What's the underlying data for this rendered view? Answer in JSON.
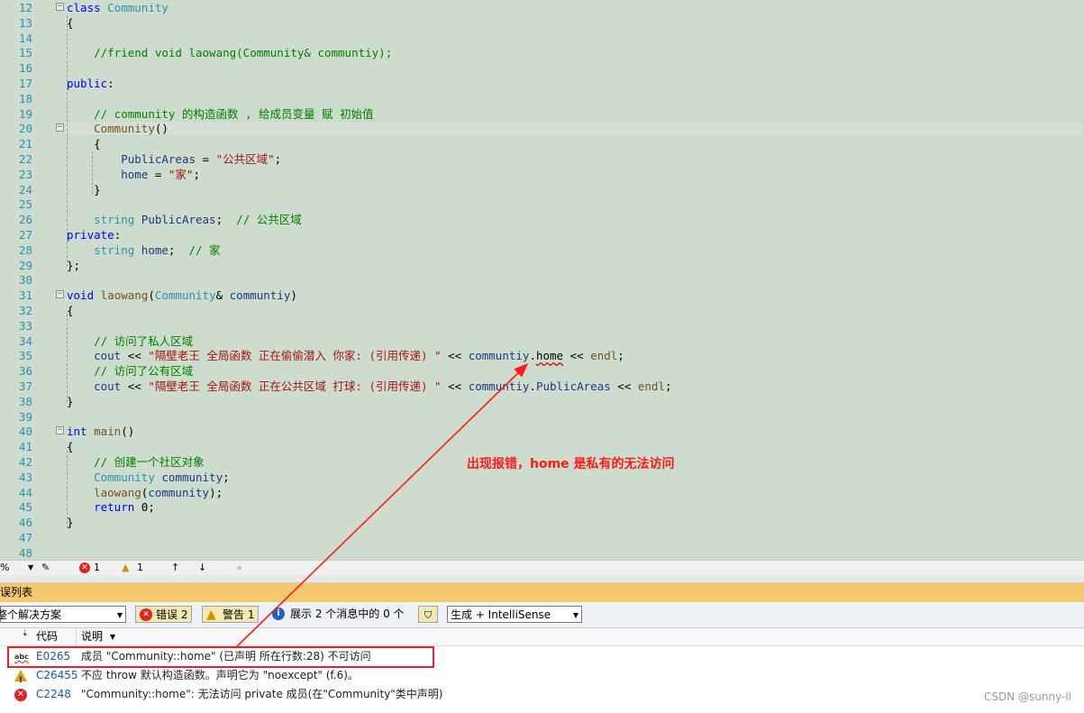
{
  "code_lines": [
    {
      "n": "12",
      "fold": "minus",
      "html": "<span class=\"kw\">class</span> <span class=\"ty\">Community</span>"
    },
    {
      "n": "13",
      "html": "{"
    },
    {
      "n": "14",
      "html": ""
    },
    {
      "n": "15",
      "html": "    <span class=\"cm\">//friend void laowang(Community&amp; communtiy);</span>"
    },
    {
      "n": "16",
      "html": ""
    },
    {
      "n": "17",
      "html": "<span class=\"kw\">public</span>:"
    },
    {
      "n": "18",
      "html": ""
    },
    {
      "n": "19",
      "html": "    <span class=\"cm\">// community 的构造函数 , 给成员变量 赋 初始值</span>"
    },
    {
      "n": "20",
      "fold": "minus",
      "html": "    <span class=\"fn\">Community</span>()"
    },
    {
      "n": "21",
      "html": "    {"
    },
    {
      "n": "22",
      "html": "        <span class=\"pa\">PublicAreas</span> = <span class=\"st\">\"公共区域\"</span>;"
    },
    {
      "n": "23",
      "html": "        <span class=\"pa\">home</span> = <span class=\"st\">\"家\"</span>;"
    },
    {
      "n": "24",
      "html": "    }"
    },
    {
      "n": "25",
      "html": ""
    },
    {
      "n": "26",
      "html": "    <span class=\"ty\">string</span> <span class=\"pa\">PublicAreas</span>;  <span class=\"cm\">// 公共区域</span>"
    },
    {
      "n": "27",
      "html": "<span class=\"kw\">private</span>:"
    },
    {
      "n": "28",
      "html": "    <span class=\"ty\">string</span> <span class=\"pa\">home</span>;  <span class=\"cm\">// 家</span>"
    },
    {
      "n": "29",
      "html": "};"
    },
    {
      "n": "30",
      "html": ""
    },
    {
      "n": "31",
      "fold": "minus",
      "html": "<span class=\"kw\">void</span> <span class=\"fn\">laowang</span>(<span class=\"ty\">Community</span>&amp; <span class=\"pa\">communtiy</span>)"
    },
    {
      "n": "32",
      "html": "{"
    },
    {
      "n": "33",
      "html": ""
    },
    {
      "n": "34",
      "html": "    <span class=\"cm\">// 访问了私人区域</span>"
    },
    {
      "n": "35",
      "html": "    <span class=\"pa\">cout</span> &lt;&lt; <span class=\"st\">\"隔壁老王 全局函数 正在偷偷潜入 你家: (引用传递) \"</span> &lt;&lt; <span class=\"pa\">communtiy</span>.<span class=\"squiggle\">home</span> &lt;&lt; <span class=\"fn\">endl</span>;"
    },
    {
      "n": "36",
      "html": "    <span class=\"cm\">// 访问了公有区域</span>"
    },
    {
      "n": "37",
      "html": "    <span class=\"pa\">cout</span> &lt;&lt; <span class=\"st\">\"隔壁老王 全局函数 正在公共区域 打球: (引用传递) \"</span> &lt;&lt; <span class=\"pa\">communtiy</span>.<span class=\"pa\">PublicAreas</span> &lt;&lt; <span class=\"fn\">endl</span>;"
    },
    {
      "n": "38",
      "html": "}"
    },
    {
      "n": "39",
      "html": ""
    },
    {
      "n": "40",
      "fold": "minus",
      "html": "<span class=\"kw\">int</span> <span class=\"fn\">main</span>()"
    },
    {
      "n": "41",
      "html": "{"
    },
    {
      "n": "42",
      "html": "    <span class=\"cm\">// 创建一个社区对象</span>"
    },
    {
      "n": "43",
      "html": "    <span class=\"ty\">Community</span> <span class=\"pa\">community</span>;"
    },
    {
      "n": "44",
      "html": "    <span class=\"fn\">laowang</span>(<span class=\"pa\">community</span>);"
    },
    {
      "n": "45",
      "html": "    <span class=\"kw\">return</span> 0;"
    },
    {
      "n": "46",
      "html": "}"
    },
    {
      "n": "47",
      "html": ""
    },
    {
      "n": "48",
      "html": ""
    }
  ],
  "status": {
    "zoom": "%",
    "errors": "1",
    "warnings": "1"
  },
  "panel": {
    "title": "误列表",
    "scope_label": "整个解决方案",
    "errors_btn": "错误 2",
    "warnings_btn": "警告 1",
    "messages_btn": "展示 2 个消息中的 0 个",
    "build_filter": "生成 + IntelliSense",
    "col_code": "代码",
    "col_desc": "说明"
  },
  "errors": [
    {
      "icon": "abc-icon",
      "code": "E0265",
      "desc": "成员 \"Community::home\" (已声明 所在行数:28) 不可访问"
    },
    {
      "icon": "warning-icon",
      "code": "C26455",
      "desc": "不应 throw 默认构造函数。声明它为 \"noexcept\" (f.6)。"
    },
    {
      "icon": "error-icon",
      "code": "C2248",
      "desc": "\"Community::home\": 无法访问 private 成员(在\"Community\"类中声明)"
    }
  ],
  "annotation": "出现报错，home 是私有的无法访问",
  "watermark": "CSDN @sunny-ll"
}
